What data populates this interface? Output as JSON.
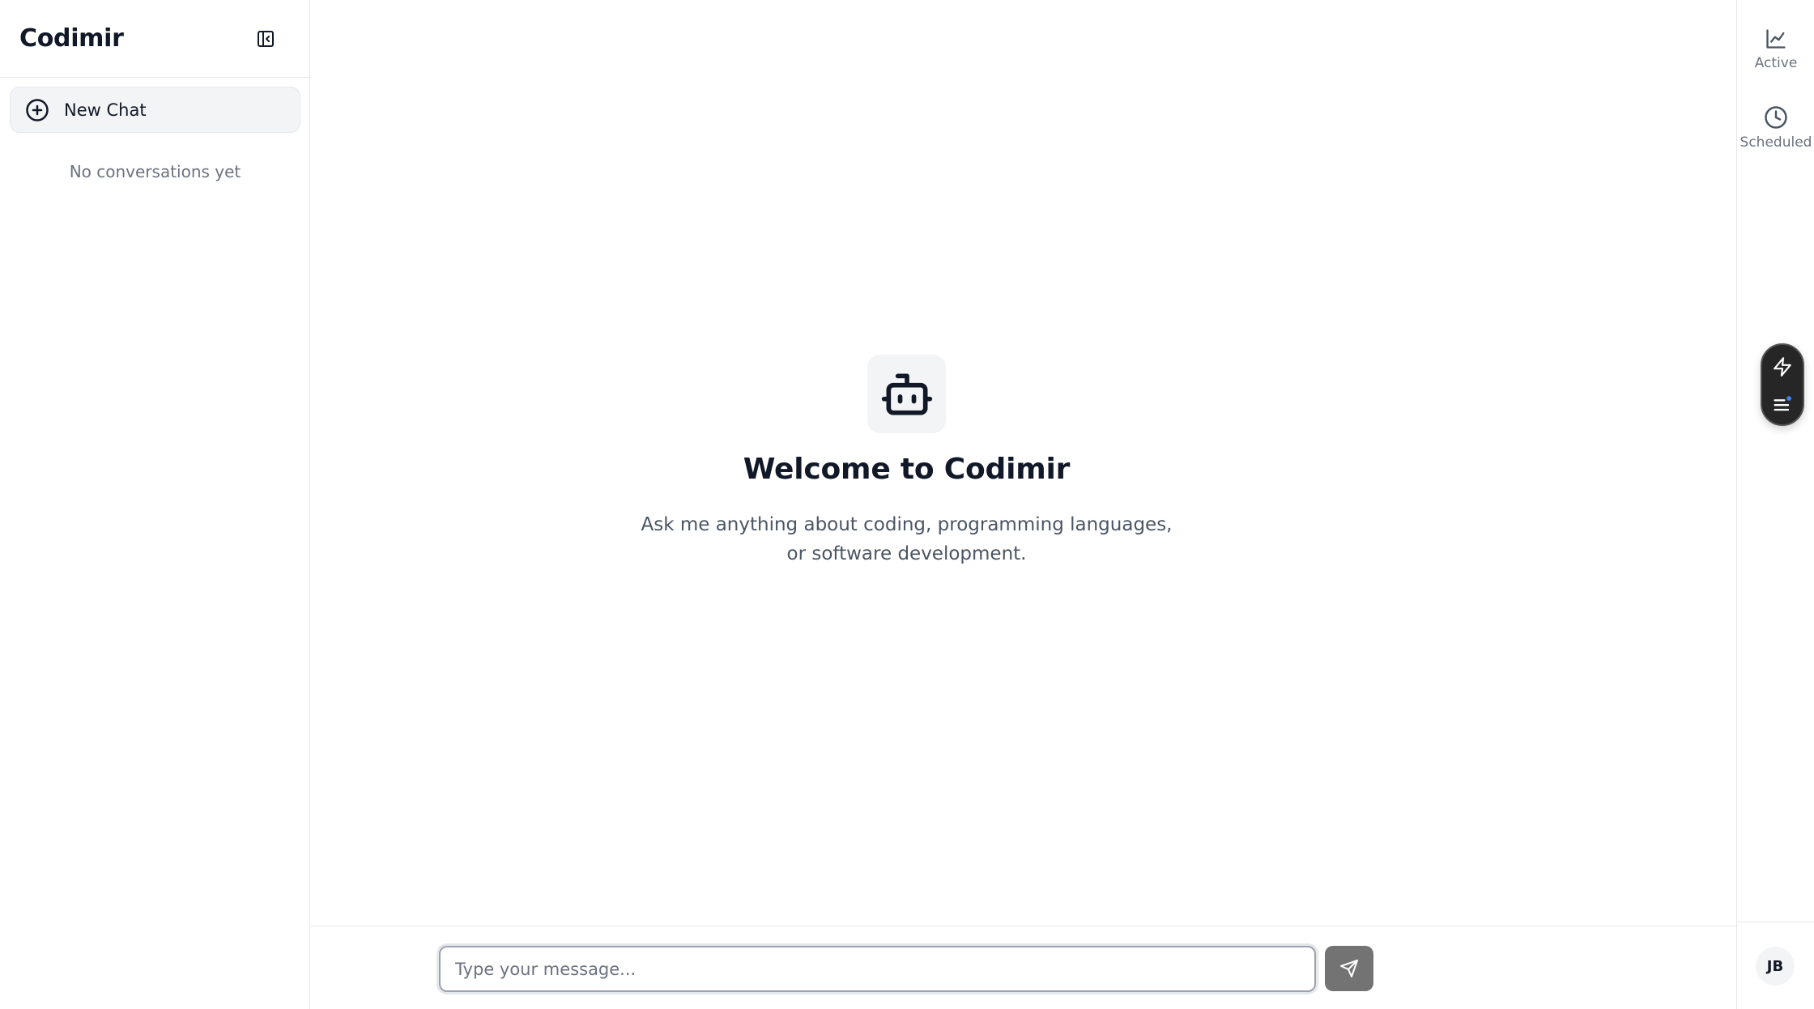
{
  "sidebar": {
    "title": "Codimir",
    "new_chat_label": "New Chat",
    "empty_text": "No conversations yet"
  },
  "main": {
    "welcome_title": "Welcome to Codimir",
    "welcome_subtitle": "Ask me anything about coding, programming languages, or software development.",
    "input_placeholder": "Type your message..."
  },
  "rail": {
    "items": [
      {
        "label": "Active",
        "icon": "line-chart-icon"
      },
      {
        "label": "Scheduled",
        "icon": "clock-icon"
      }
    ],
    "avatar_initials": "JB"
  },
  "colors": {
    "accent_dark": "#262626",
    "send_button": "#737373",
    "notification_dot": "#3b82f6",
    "muted_text": "#6b7280"
  }
}
